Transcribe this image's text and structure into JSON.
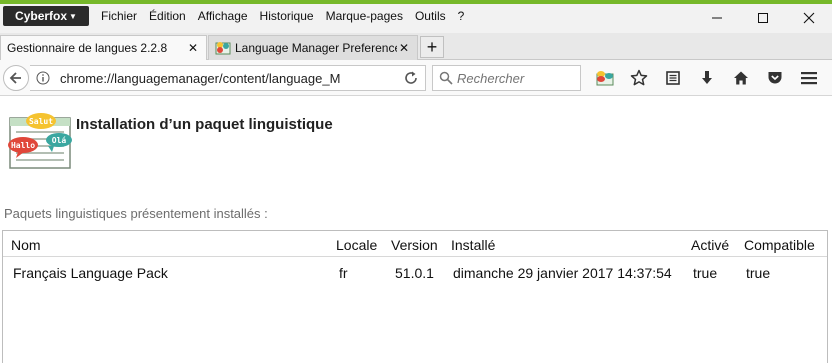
{
  "app": {
    "name": "Cyberfox"
  },
  "menu": [
    "Fichier",
    "Édition",
    "Affichage",
    "Historique",
    "Marque-pages",
    "Outils",
    "?"
  ],
  "tabs": [
    {
      "label": "Gestionnaire de langues 2.2.8",
      "active": true
    },
    {
      "label": "Language Manager Preferences",
      "active": false
    }
  ],
  "nav": {
    "url": "chrome://languagemanager/content/language_M",
    "search_placeholder": "Rechercher"
  },
  "page": {
    "title": "Installation d’un paquet linguistique",
    "logo_bubbles": [
      "Salut",
      "Hallo",
      "Olá"
    ],
    "subtitle": "Paquets linguistiques présentement installés :"
  },
  "table": {
    "columns": [
      "Nom",
      "Locale",
      "Version",
      "Installé",
      "Activé",
      "Compatible"
    ],
    "rows": [
      [
        "Français Language Pack",
        "fr",
        "51.0.1",
        "dimanche 29 janvier 2017 14:37:54",
        "true",
        "true"
      ]
    ]
  },
  "colors": {
    "accent": "#76b82a",
    "app_button": "#2b2b2b",
    "subtitle": "#6d6d6d"
  }
}
